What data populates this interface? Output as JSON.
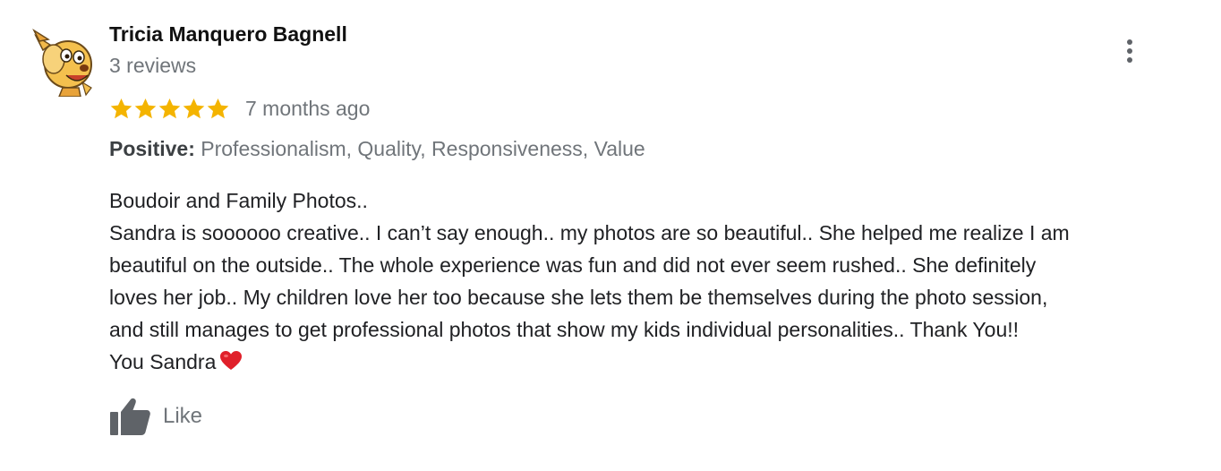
{
  "review": {
    "reviewer_name": "Tricia Manquero Bagnell",
    "review_count": "3 reviews",
    "rating": 5,
    "rating_max": 5,
    "date": "7 months ago",
    "attributes": {
      "label": "Positive:",
      "values": " Professionalism, Quality, Responsiveness, Value"
    },
    "text_lines": [
      "Boudoir and Family Photos..",
      "Sandra is soooooo creative.. I can’t say enough..  my photos are so beautiful.. She helped me realize I am",
      "beautiful on the outside..  The whole experience was fun and did not ever seem rushed.. She definitely",
      "loves her job.. My children love her too because she lets them be themselves during the photo session,",
      "and still manages to get professional photos that show my kids individual personalities..  Thank You!!",
      "You Sandra"
    ],
    "like_label": "Like"
  },
  "icons": {
    "avatar": "cartoon-character-avatar",
    "star": "star-icon",
    "heart": "heart-icon",
    "thumb": "thumbs-up-icon",
    "more": "more-vertical-icon"
  },
  "colors": {
    "star": "#f4b400",
    "heart": "#e0202a",
    "muted_text": "#70757a",
    "icon_gray": "#5f6368"
  }
}
